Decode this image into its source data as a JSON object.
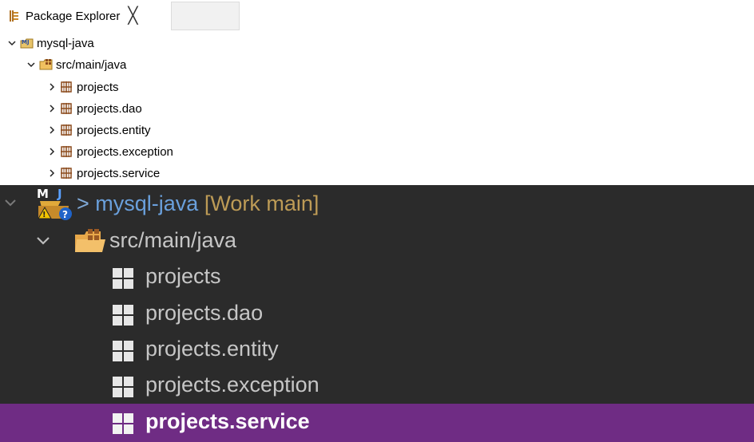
{
  "light_view": {
    "tab": {
      "label": "Package Explorer",
      "icon": "package-explorer-icon",
      "close_glyph": "╳"
    },
    "tree": [
      {
        "label": "mysql-java",
        "icon": "java-project-icon",
        "expanded": true,
        "level": 0
      },
      {
        "label": "src/main/java",
        "icon": "source-folder-icon",
        "expanded": true,
        "level": 1
      },
      {
        "label": "projects",
        "icon": "package-icon",
        "expanded": false,
        "level": 2
      },
      {
        "label": "projects.dao",
        "icon": "package-icon",
        "expanded": false,
        "level": 2
      },
      {
        "label": "projects.entity",
        "icon": "package-icon",
        "expanded": false,
        "level": 2
      },
      {
        "label": "projects.exception",
        "icon": "package-icon",
        "expanded": false,
        "level": 2
      },
      {
        "label": "projects.service",
        "icon": "package-icon",
        "expanded": false,
        "level": 2
      }
    ]
  },
  "dark_view": {
    "project": {
      "prefix": "> ",
      "label": "mysql-java",
      "decorator": "[Work main]",
      "icon": "maven-java-project-warning-icon",
      "icon_text": "M J"
    },
    "source_folder": {
      "label": "src/main/java",
      "icon": "source-folder-icon"
    },
    "packages": [
      {
        "label": "projects",
        "selected": false
      },
      {
        "label": "projects.dao",
        "selected": false
      },
      {
        "label": "projects.entity",
        "selected": false
      },
      {
        "label": "projects.exception",
        "selected": false
      },
      {
        "label": "projects.service",
        "selected": true
      }
    ]
  },
  "colors": {
    "dark_bg": "#2b2b2b",
    "selection": "#6f2c84",
    "project_text": "#5a9bd8",
    "decorator": "#bd9b56",
    "package_brown": "#8b4a1c"
  }
}
